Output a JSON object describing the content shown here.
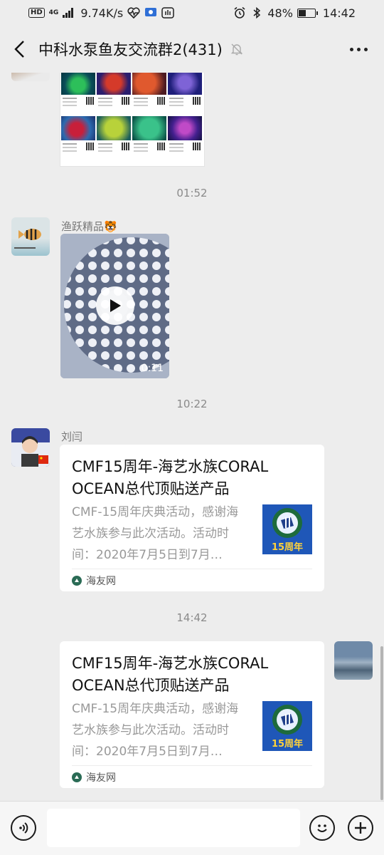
{
  "status_bar": {
    "hd": "HD",
    "network": "4G",
    "speed": "9.74K/s",
    "battery_text": "48%",
    "battery_level": 0.48,
    "clock": "14:42"
  },
  "header": {
    "title": "中科水泵鱼友交流群2(431)"
  },
  "messages": {
    "time1": "01:52",
    "sender1": "渔跃精品🐯",
    "video_duration": "0:11",
    "time2": "10:22",
    "sender2": "刘闫",
    "time3": "14:42"
  },
  "card_in": {
    "title": "CMF15周年-海艺水族CORAL OCEAN总代顶贴送产品",
    "desc": "CMF-15周年庆典活动，感谢海艺水族参与此次活动。活动时间：2020年7月5日到7月…",
    "thumb_badge": "15周年",
    "source": "海友网"
  },
  "card_out": {
    "title": "CMF15周年-海艺水族CORAL OCEAN总代顶贴送产品",
    "desc": "CMF-15周年庆典活动，感谢海艺水族参与此次活动。活动时间：2020年7月5日到7月…",
    "thumb_badge": "15周年",
    "source": "海友网"
  },
  "input_bar": {
    "placeholder": ""
  },
  "colors": {
    "background": "#ededed",
    "card": "#ffffff",
    "source_icon": "#2a6b55"
  },
  "icons": [
    "back-arrow-icon",
    "mute-bell-icon",
    "more-icon",
    "voice-icon",
    "emoji-icon",
    "add-icon",
    "play-icon"
  ]
}
